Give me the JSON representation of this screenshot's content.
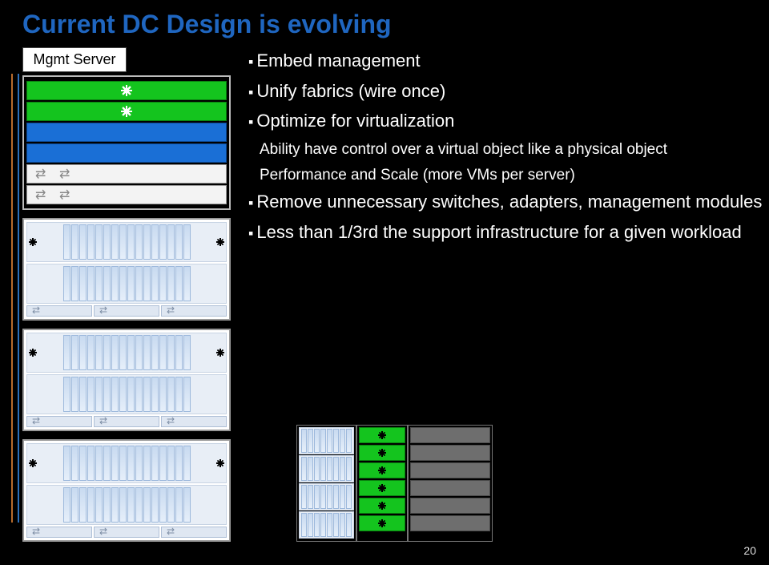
{
  "title": "Current DC Design is evolving",
  "left": {
    "mgmt_label": "Mgmt Server"
  },
  "bullets": {
    "b1": "Embed management",
    "b2": "Unify fabrics (wire once)",
    "b3": "Optimize for virtualization",
    "b3_sub1": "Ability have control over a virtual object like a physical object",
    "b3_sub2": "Performance and Scale (more VMs per server)",
    "b4": "Remove unnecessary  switches, adapters, management modules",
    "b5": "Less than 1/3rd the support infrastructure for a given workload"
  },
  "page_number": "20"
}
